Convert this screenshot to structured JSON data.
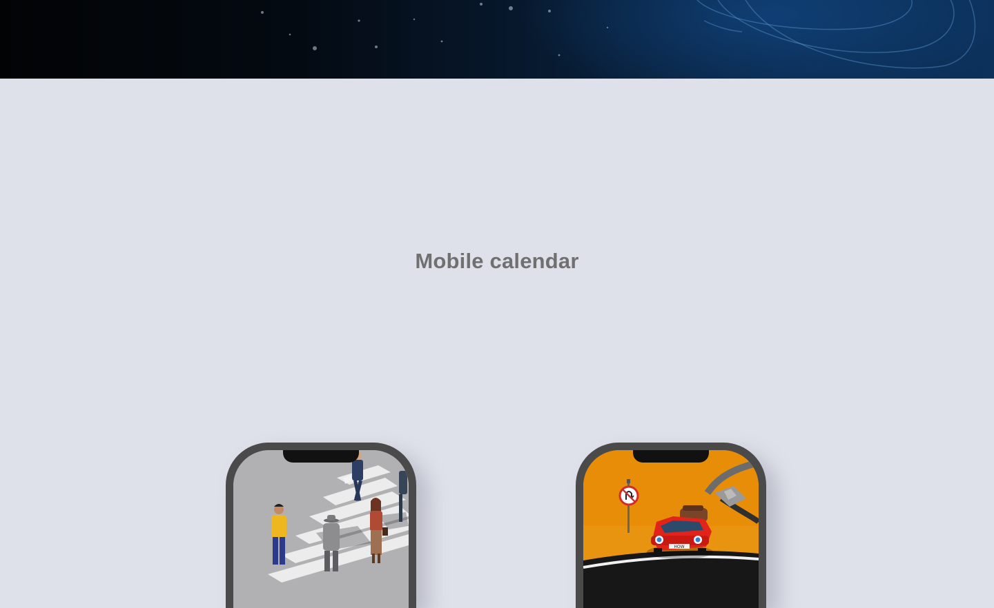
{
  "hero": {
    "name": "dark-space-banner"
  },
  "section": {
    "title": "Mobile calendar"
  },
  "phones": [
    {
      "name": "phone-crosswalk-illustration",
      "scene": "crosswalk with pedestrians"
    },
    {
      "name": "phone-car-illustration",
      "scene": "red car on orange road with no-U-turn sign"
    }
  ],
  "sign": {
    "plate_text": "HOW"
  },
  "colors": {
    "page_bg": "#dfe1ea",
    "title": "#707070",
    "phone_frame": "#4a4a4a",
    "orange": "#e98e06",
    "car_red": "#e2231a"
  }
}
